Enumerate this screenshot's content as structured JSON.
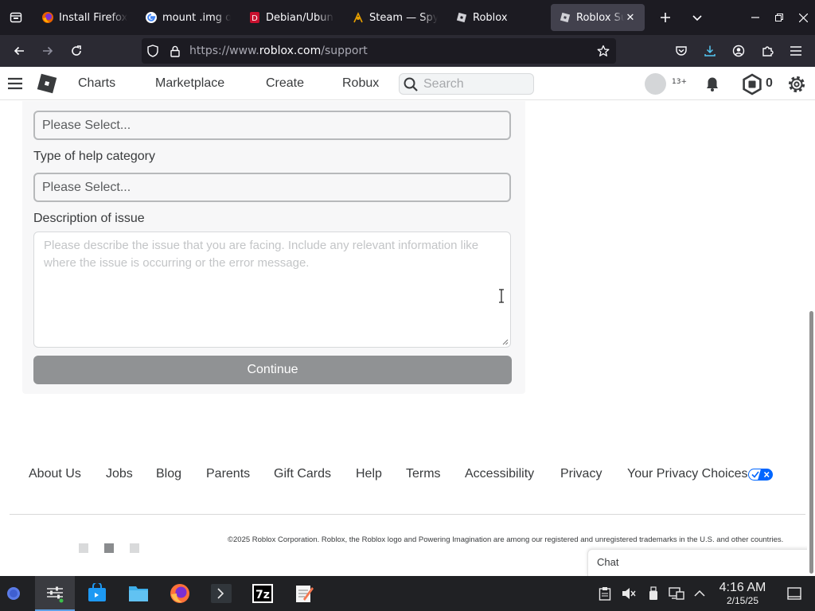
{
  "browser": {
    "tabs": [
      {
        "title": "Install Firefox",
        "favicon": "firefox-icon"
      },
      {
        "title": "mount .img o",
        "favicon": "google-icon"
      },
      {
        "title": "Debian/Ubun",
        "favicon": "debian-icon"
      },
      {
        "title": "Steam — Spy",
        "favicon": "steam-icon"
      },
      {
        "title": "Roblox",
        "favicon": "roblox-icon"
      },
      {
        "title": "Roblox Sup",
        "favicon": "roblox-icon",
        "active": true
      }
    ],
    "url": {
      "scheme": "https://www.",
      "host": "roblox.com",
      "path": "/support"
    }
  },
  "header": {
    "nav": [
      "Charts",
      "Marketplace",
      "Create",
      "Robux"
    ],
    "search_placeholder": "Search",
    "age_badge": "13+",
    "robux_balance": "0"
  },
  "form": {
    "select1_placeholder": "Please Select...",
    "help_category_label": "Type of help category",
    "select2_placeholder": "Please Select...",
    "description_label": "Description of issue",
    "description_placeholder": "Please describe the issue that you are facing. Include any relevant information like where the issue is occurring or the error message.",
    "continue_label": "Continue"
  },
  "footer": {
    "links": [
      "About Us",
      "Jobs",
      "Blog",
      "Parents",
      "Gift Cards",
      "Help",
      "Terms",
      "Accessibility",
      "Privacy",
      "Your Privacy Choices"
    ],
    "legal": "©2025 Roblox Corporation. Roblox, the Roblox logo and Powering Imagination are among our registered and unregistered trademarks in the U.S. and other countries."
  },
  "chat": {
    "label": "Chat"
  },
  "taskbar": {
    "apps": [
      "system-settings-icon",
      "discover-store-icon",
      "file-manager-icon",
      "firefox-icon",
      "terminal-icon",
      "7zip-icon",
      "text-editor-icon"
    ],
    "time": "4:16 AM",
    "date": "2/15/25"
  },
  "colors": {
    "accent": "#5fa0e6",
    "privacy_toggle": "#0066ff",
    "continue_disabled": "#909294"
  }
}
